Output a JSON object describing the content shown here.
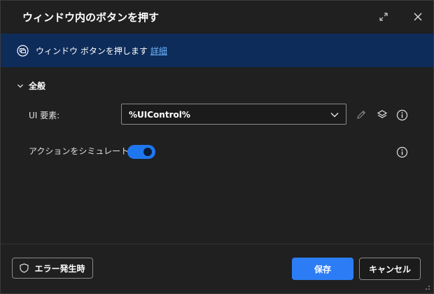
{
  "dialog": {
    "title": "ウィンドウ内のボタンを押す",
    "expand_icon": "expand-icon",
    "close_icon": "close-icon"
  },
  "banner": {
    "text": "ウィンドウ ボタンを押します",
    "link": "詳細",
    "icon": "window-action-icon"
  },
  "section": {
    "title": "全般",
    "expanded": true
  },
  "fields": {
    "ui_element": {
      "label": "UI 要素:",
      "value": "%UIControl%"
    },
    "simulate": {
      "label": "アクションをシミュレートする:",
      "on": true
    }
  },
  "footer": {
    "error_button": "エラー発生時",
    "save_button": "保存",
    "cancel_button": "キャンセル"
  },
  "colors": {
    "background": "#202020",
    "banner": "#0e2c5a",
    "accent": "#2c7df5",
    "link": "#6cb4ff"
  }
}
